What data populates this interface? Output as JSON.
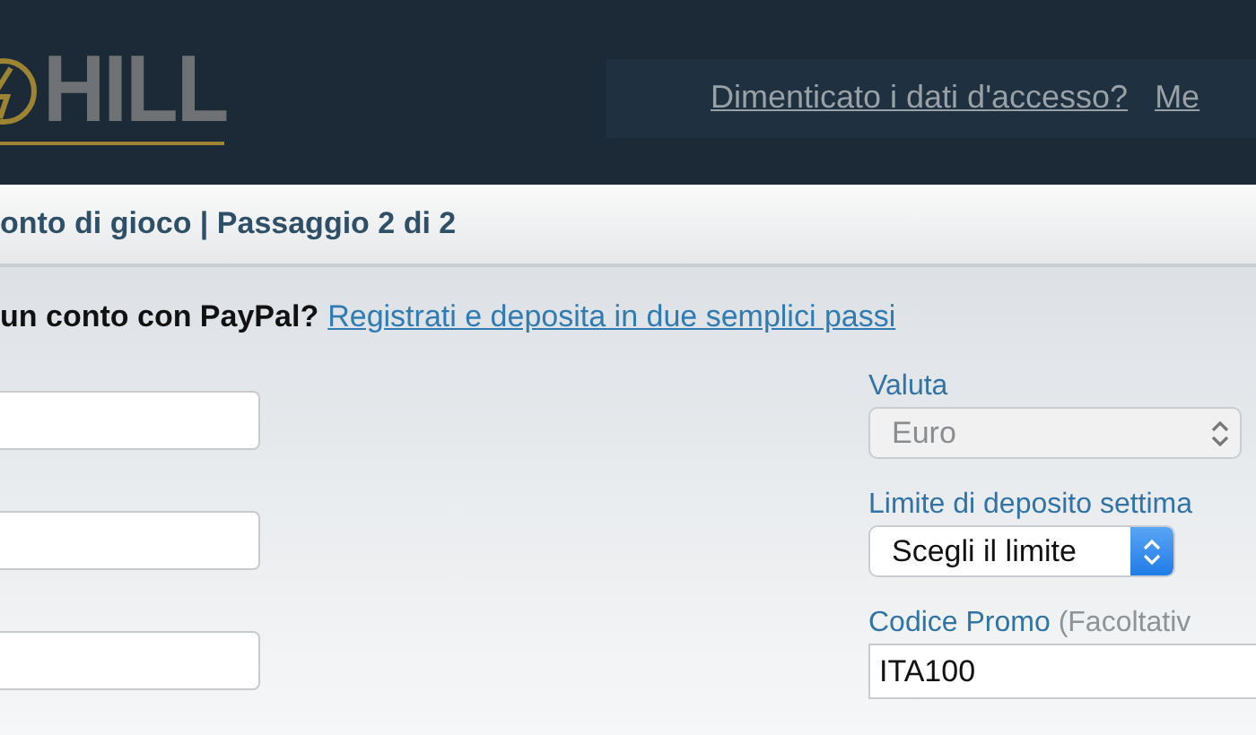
{
  "header": {
    "logo_text": "HILL",
    "links": [
      {
        "label": "Dimenticato i dati d'accesso?"
      },
      {
        "label": "Me"
      }
    ]
  },
  "step_heading": "onto di gioco | Passaggio 2 di 2",
  "paypal_prompt": {
    "text": "un conto con PayPal?",
    "link": "Registrati e deposita in due semplici passi"
  },
  "left_fields": [
    {
      "disabled": false
    },
    {
      "disabled": false
    },
    {
      "disabled": false
    }
  ],
  "right_fields": [
    {
      "kind": "select",
      "label": "Valuta",
      "value": "Euro",
      "disabled": true
    },
    {
      "kind": "select",
      "label": "Limite di deposito settima",
      "value": "Scegli il limite",
      "disabled": false
    },
    {
      "kind": "input",
      "label": "Codice Promo",
      "hint": "(Facoltativ",
      "value": "ITA100",
      "disabled": false
    }
  ]
}
